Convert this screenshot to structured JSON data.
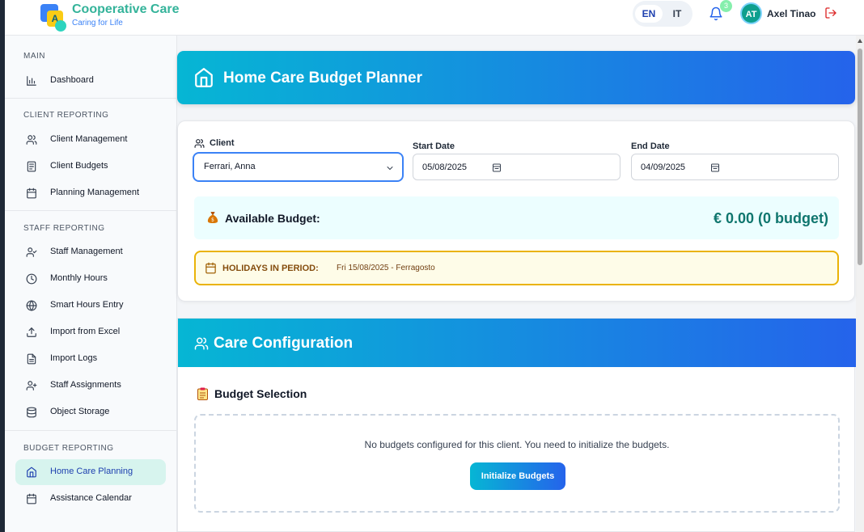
{
  "brand": {
    "name": "Cooperative Care",
    "tagline": "Caring for Life",
    "logo_letter": "A"
  },
  "header": {
    "languages": [
      "EN",
      "IT"
    ],
    "active_language": "EN",
    "notification_count": "3",
    "user_initials": "AT",
    "user_name": "Axel Tinao",
    "icons": [
      "bell-icon",
      "logout-icon"
    ]
  },
  "sidebar": {
    "sections": [
      {
        "title": "MAIN",
        "items": [
          {
            "label": "Dashboard",
            "icon": "bar-chart-icon"
          }
        ]
      },
      {
        "title": "CLIENT REPORTING",
        "items": [
          {
            "label": "Client Management",
            "icon": "users-icon"
          },
          {
            "label": "Client Budgets",
            "icon": "document-icon"
          },
          {
            "label": "Planning Management",
            "icon": "calendar-icon"
          }
        ]
      },
      {
        "title": "STAFF REPORTING",
        "items": [
          {
            "label": "Staff Management",
            "icon": "user-check-icon"
          },
          {
            "label": "Monthly Hours",
            "icon": "clock-icon"
          },
          {
            "label": "Smart Hours Entry",
            "icon": "globe-icon"
          },
          {
            "label": "Import from Excel",
            "icon": "upload-icon"
          },
          {
            "label": "Import Logs",
            "icon": "file-text-icon"
          },
          {
            "label": "Staff Assignments",
            "icon": "user-plus-icon"
          },
          {
            "label": "Object Storage",
            "icon": "database-icon"
          }
        ]
      },
      {
        "title": "BUDGET REPORTING",
        "items": [
          {
            "label": "Home Care Planning",
            "icon": "home-icon",
            "active": true
          },
          {
            "label": "Assistance Calendar",
            "icon": "calendar-icon"
          }
        ]
      }
    ]
  },
  "page": {
    "title": "Home Care Budget Planner",
    "title_icon": "home-icon"
  },
  "filters": {
    "client_label": "Client",
    "client_value": "Ferrari, Anna",
    "start_label": "Start Date",
    "start_value": "05/08/2025",
    "end_label": "End Date",
    "end_value": "04/09/2025"
  },
  "budget": {
    "label": "Available Budget:",
    "value": "€ 0.00 (0 budget)",
    "icon": "money-bag-icon"
  },
  "holidays": {
    "label": "HOLIDAYS IN PERIOD:",
    "value": "Fri 15/08/2025 - Ferragosto"
  },
  "care": {
    "title": "Care Configuration",
    "section_title": "Budget Selection",
    "empty_message": "No budgets configured for this client. You need to initialize the budgets.",
    "button_label": "Initialize Budgets"
  },
  "colors": {
    "accent": "#2563eb",
    "accent_cyan": "#06b6d4",
    "brand_green": "#34b39a",
    "budget_teal": "#0f766e",
    "holiday_yellow": "#eab308"
  }
}
